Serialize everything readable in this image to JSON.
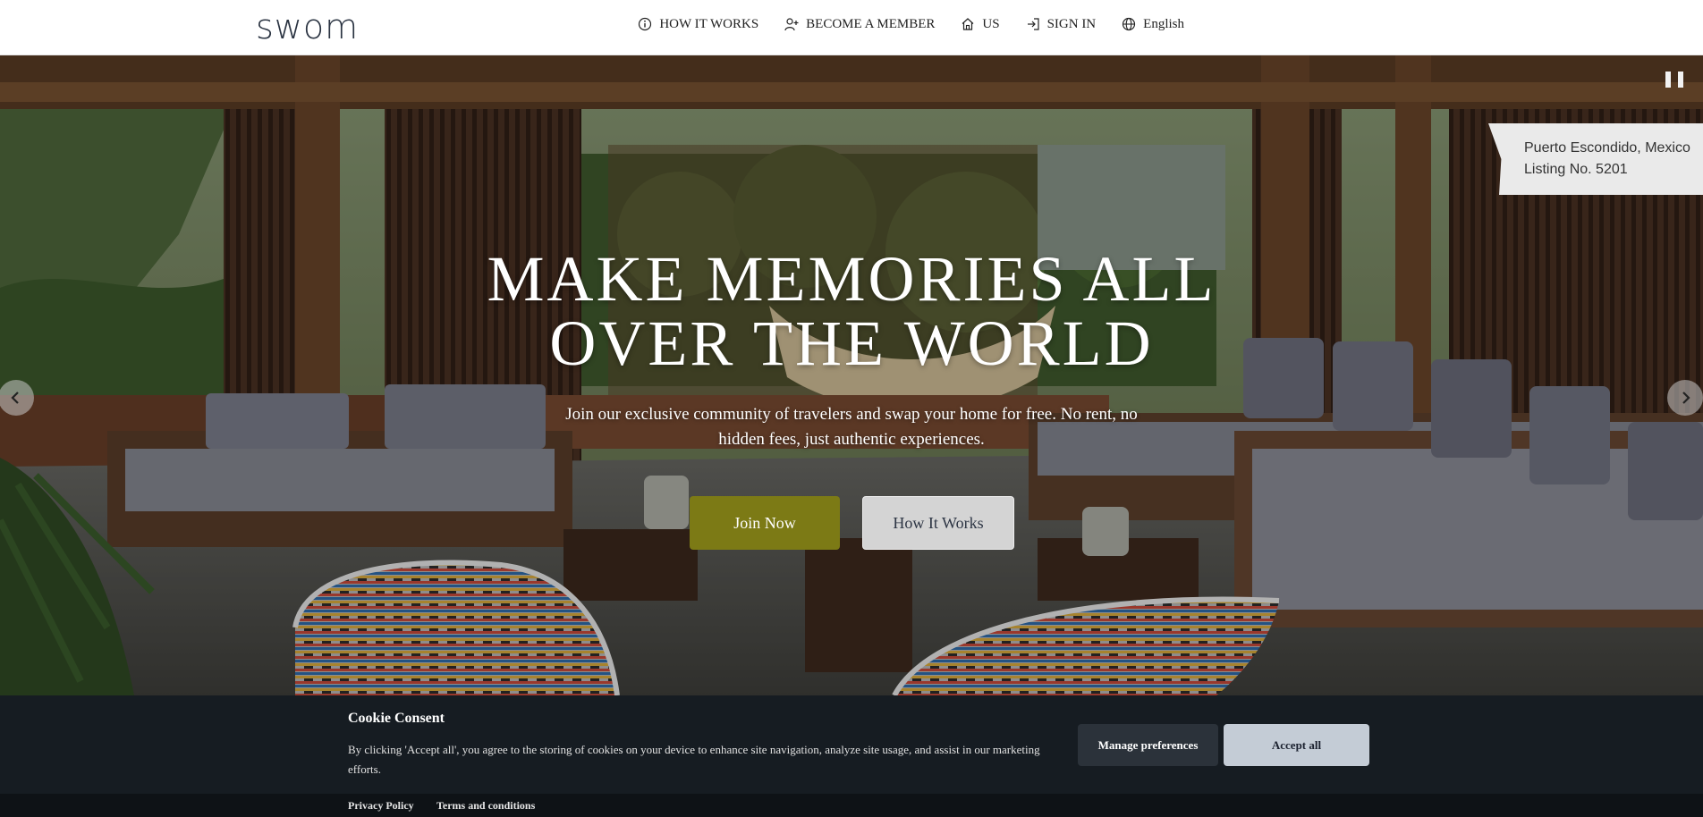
{
  "header": {
    "logo_text": "swom",
    "nav": [
      {
        "icon": "info-icon",
        "label": "HOW IT WORKS"
      },
      {
        "icon": "user-plus-icon",
        "label": "BECOME A MEMBER"
      },
      {
        "icon": "home-icon",
        "label": "US"
      },
      {
        "icon": "sign-in-icon",
        "label": "SIGN IN"
      },
      {
        "icon": "globe-icon",
        "label": "English"
      }
    ]
  },
  "hero": {
    "title_line1": "MAKE MEMORIES ALL",
    "title_line2": "OVER THE WORLD",
    "subtitle": "Join our exclusive community of travelers and swap your home for free. No rent, no hidden fees, just authentic experiences.",
    "join_label": "Join Now",
    "how_label": "How It Works",
    "listing_location": "Puerto Escondido, Mexico",
    "listing_number": "Listing No. 5201"
  },
  "cookie": {
    "title": "Cookie Consent",
    "text": "By clicking 'Accept all', you agree to the storing of cookies on your device to enhance site navigation, analyze site usage, and assist in our marketing efforts.",
    "manage_label": "Manage preferences",
    "accept_label": "Accept all",
    "privacy_label": "Privacy Policy",
    "terms_label": "Terms and conditions"
  },
  "colors": {
    "join_button": "#7c7a15",
    "cookie_bar": "#161c22",
    "accept_button": "#c4ccd6"
  }
}
